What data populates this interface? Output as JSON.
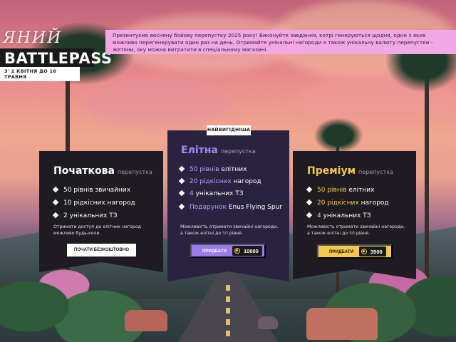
{
  "logo": {
    "script_text": "ЯНИЙ",
    "title": "BATTLEPASS",
    "date_range": "З' 2 КВІТНЯ ДО 16 ТРАВНЯ"
  },
  "intro": {
    "text": "Презентуємо весняну бойову перепустку 2025 року! Виконуйте завдання, котрі генеруються щодня, одне з яких можливо перегенерувати один раз на день. Отримайте унікальні нагороди а також унікальну валюту перепустки - жетони, яку можна витратити в спеціальному магазині."
  },
  "cards": {
    "basic": {
      "title": "Початкова",
      "subtitle": "перепустка",
      "features": [
        "50 рівнів звичайних",
        "10 рідкісних нагород",
        "2 унікальних ТЗ"
      ],
      "note": "Отримати доступ до елітних нагород можливо будь-коли.",
      "button_label": "ПОЧАТИ БЕЗКОШТОВНО"
    },
    "elite": {
      "badge": "НАЙВИГІДНІША",
      "title": "Елітна",
      "subtitle": "перепустка",
      "features": [
        {
          "hl": "50 рівнів",
          "rest": " елітних"
        },
        {
          "hl": "20 рідкісних",
          "rest": " нагород"
        },
        {
          "hl": "4",
          "rest": " унікальних ТЗ"
        },
        {
          "hl": "Подарунок",
          "rest": " Enus Flying Spur"
        }
      ],
      "note_a": "Можливість отримати звичайні нагороди, а також елітні до ",
      "note_hl": "50",
      "note_b": " рівня.",
      "button_label": "ПРИДБАТИ",
      "price": "10000"
    },
    "premium": {
      "title": "Преміум",
      "subtitle": "перепустка",
      "features": [
        {
          "hl": "50 рівнів",
          "rest": " елітних"
        },
        {
          "hl": "20 рідкісних",
          "rest": " нагород"
        },
        {
          "hl": "4",
          "rest": " унікальних ТЗ"
        }
      ],
      "note_a": "Можливість отримати звичайні нагороди, а також елітні до ",
      "note_hl": "50",
      "note_b": " рівня.",
      "button_label": "ПРИДБАТИ",
      "price": "3500"
    }
  },
  "colors": {
    "elite_accent": "#9b7af0",
    "premium_accent": "#f2c94c",
    "intro_bg": "#f2a8e6",
    "card_bg": "#1e1b22"
  }
}
